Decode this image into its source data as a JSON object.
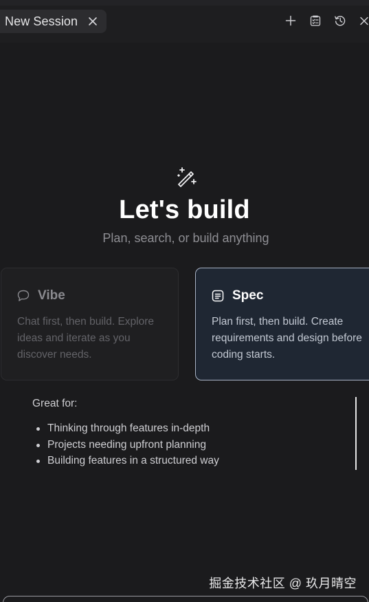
{
  "tab": {
    "label": "New Session",
    "close_icon": "close-icon"
  },
  "toolbar": {
    "icons": [
      "plus-icon",
      "checklist-icon",
      "history-icon",
      "close-icon"
    ]
  },
  "hero": {
    "icon": "magic-wand-icon",
    "title": "Let's build",
    "subtitle": "Plan, search, or build anything"
  },
  "modes": [
    {
      "icon": "chat-bubble-icon",
      "title": "Vibe",
      "description": "Chat first, then build. Explore ideas and iterate as you discover needs.",
      "selected": false
    },
    {
      "icon": "document-icon",
      "title": "Spec",
      "description": "Plan first, then build. Create requirements and design before coding starts.",
      "selected": true
    }
  ],
  "great_for": {
    "label": "Great for:",
    "items": [
      "Thinking through features in-depth",
      "Projects needing upfront planning",
      "Building features in a structured way"
    ]
  },
  "watermark": "掘金技术社区 @ 玖月晴空",
  "colors": {
    "background": "#1b1b1d",
    "selected_card_bg": "#1f2733",
    "selected_card_border": "#a9b4c6"
  }
}
